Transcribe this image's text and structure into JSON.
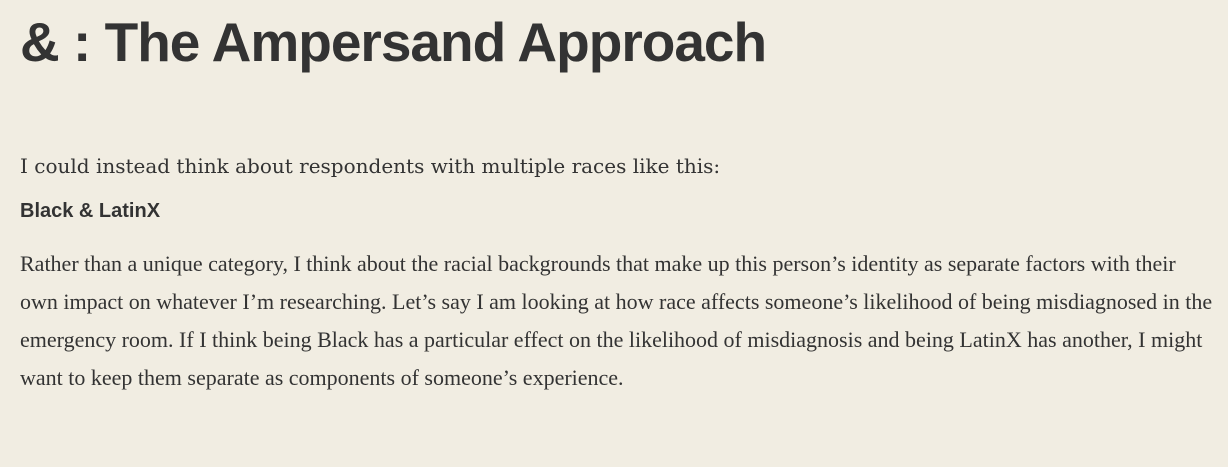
{
  "article": {
    "heading": "& : The Ampersand Approach",
    "intro": "I could instead think about respondents with multiple races like this:",
    "subheading": "Black & LatinX",
    "body": "Rather than a unique category, I think about the racial backgrounds that make up this person’s identity as separate factors with their own impact on whatever I’m researching. Let’s say I am looking at how race affects someone’s likelihood of being misdiagnosed in the emergency room. If I think being Black has a particular effect on the likelihood of misdiagnosis and being LatinX has another, I might want to keep them separate as components of someone’s experience."
  }
}
